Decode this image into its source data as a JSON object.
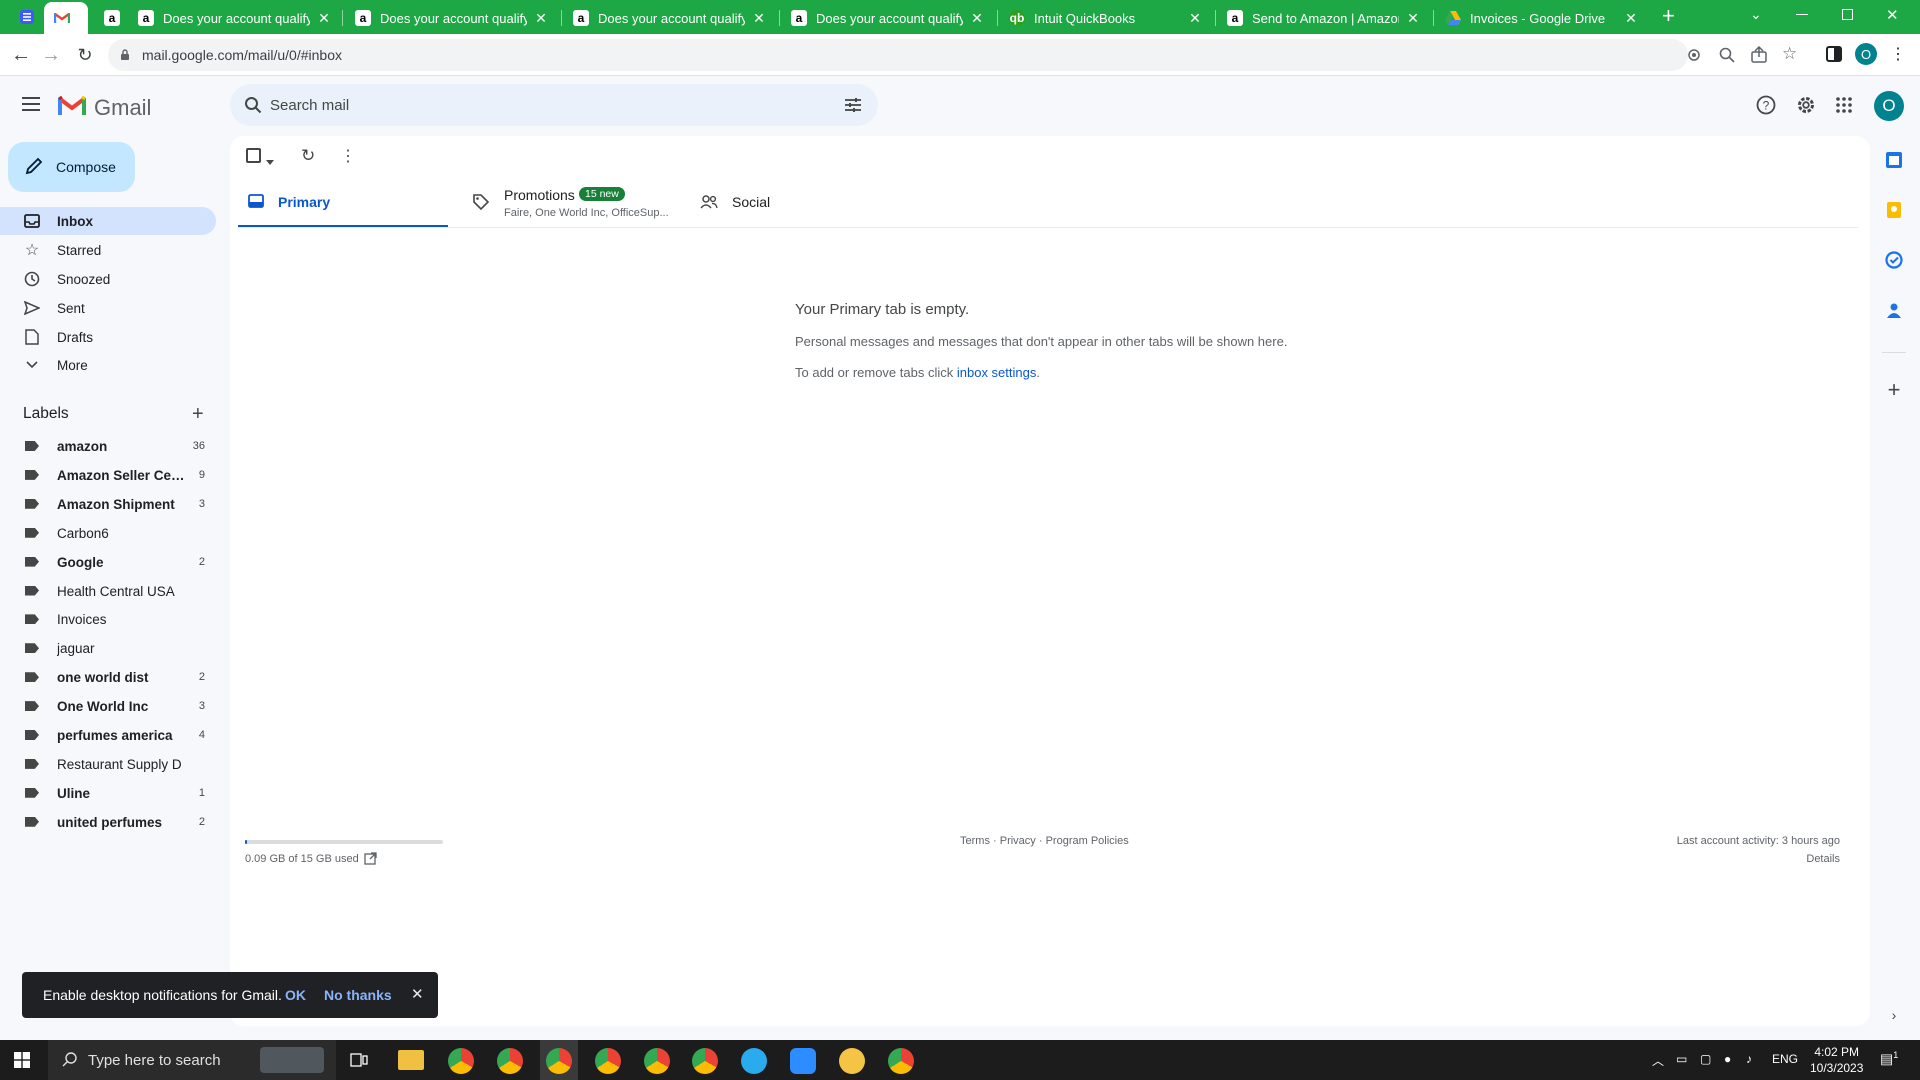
{
  "browser": {
    "tabs": [
      {
        "title": "Does your account qualify?",
        "favicon": "amazon"
      },
      {
        "title": "Does your account qualify?",
        "favicon": "amazon"
      },
      {
        "title": "Does your account qualify?",
        "favicon": "amazon"
      },
      {
        "title": "Does your account qualify?",
        "favicon": "amazon"
      },
      {
        "title": "Intuit QuickBooks",
        "favicon": "quickbooks"
      },
      {
        "title": "Send to Amazon | Amazon S",
        "favicon": "amazon"
      },
      {
        "title": "Invoices - Google Drive",
        "favicon": "google-drive"
      }
    ],
    "url": "mail.google.com/mail/u/0/#inbox",
    "profile_initial": "O",
    "accent": "#1da845"
  },
  "gmail": {
    "product_name": "Gmail",
    "search_placeholder": "Search mail",
    "compose": "Compose",
    "avatar_initial": "O",
    "nav": [
      {
        "label": "Inbox",
        "icon": "inbox-icon",
        "selected": true
      },
      {
        "label": "Starred",
        "icon": "star-icon"
      },
      {
        "label": "Snoozed",
        "icon": "clock-icon"
      },
      {
        "label": "Sent",
        "icon": "send-icon"
      },
      {
        "label": "Drafts",
        "icon": "draft-icon"
      },
      {
        "label": "More",
        "icon": "chevron-down-icon"
      }
    ],
    "labels_heading": "Labels",
    "labels": [
      {
        "name": "amazon",
        "count": "36",
        "bold": true
      },
      {
        "name": "Amazon Seller Cen...",
        "count": "9",
        "bold": true
      },
      {
        "name": "Amazon Shipment",
        "count": "3",
        "bold": true
      },
      {
        "name": "Carbon6",
        "count": "",
        "bold": false
      },
      {
        "name": "Google",
        "count": "2",
        "bold": true
      },
      {
        "name": "Health Central USA",
        "count": "",
        "bold": false
      },
      {
        "name": "Invoices",
        "count": "",
        "bold": false
      },
      {
        "name": "jaguar",
        "count": "",
        "bold": false
      },
      {
        "name": "one world dist",
        "count": "2",
        "bold": true
      },
      {
        "name": "One World Inc",
        "count": "3",
        "bold": true
      },
      {
        "name": "perfumes america",
        "count": "4",
        "bold": true
      },
      {
        "name": "Restaurant Supply D",
        "count": "",
        "bold": false
      },
      {
        "name": "Uline",
        "count": "1",
        "bold": true
      },
      {
        "name": "united perfumes",
        "count": "2",
        "bold": true
      }
    ],
    "tabs": {
      "primary": "Primary",
      "promotions": "Promotions",
      "promotions_badge": "15 new",
      "promotions_sub": "Faire, One World Inc, OfficeSup...",
      "social": "Social"
    },
    "empty": {
      "title": "Your Primary tab is empty.",
      "line1": "Personal messages and messages that don't appear in other tabs will be shown here.",
      "line2_prefix": "To add or remove tabs click ",
      "line2_link": "inbox settings",
      "line2_suffix": "."
    },
    "footer": {
      "storage": "0.09 GB of 15 GB used",
      "storage_fraction": 0.006,
      "terms": "Terms",
      "sep": " · ",
      "privacy": "Privacy",
      "policies": "Program Policies",
      "activity": "Last account activity: 3 hours ago",
      "details": "Details"
    },
    "snackbar": {
      "text": "Enable desktop notifications for Gmail.",
      "ok": "OK",
      "no": "No thanks"
    }
  },
  "taskbar": {
    "search_placeholder": "Type here to search",
    "language": "ENG",
    "time": "4:02 PM",
    "date": "10/3/2023",
    "notif_count": "1"
  }
}
